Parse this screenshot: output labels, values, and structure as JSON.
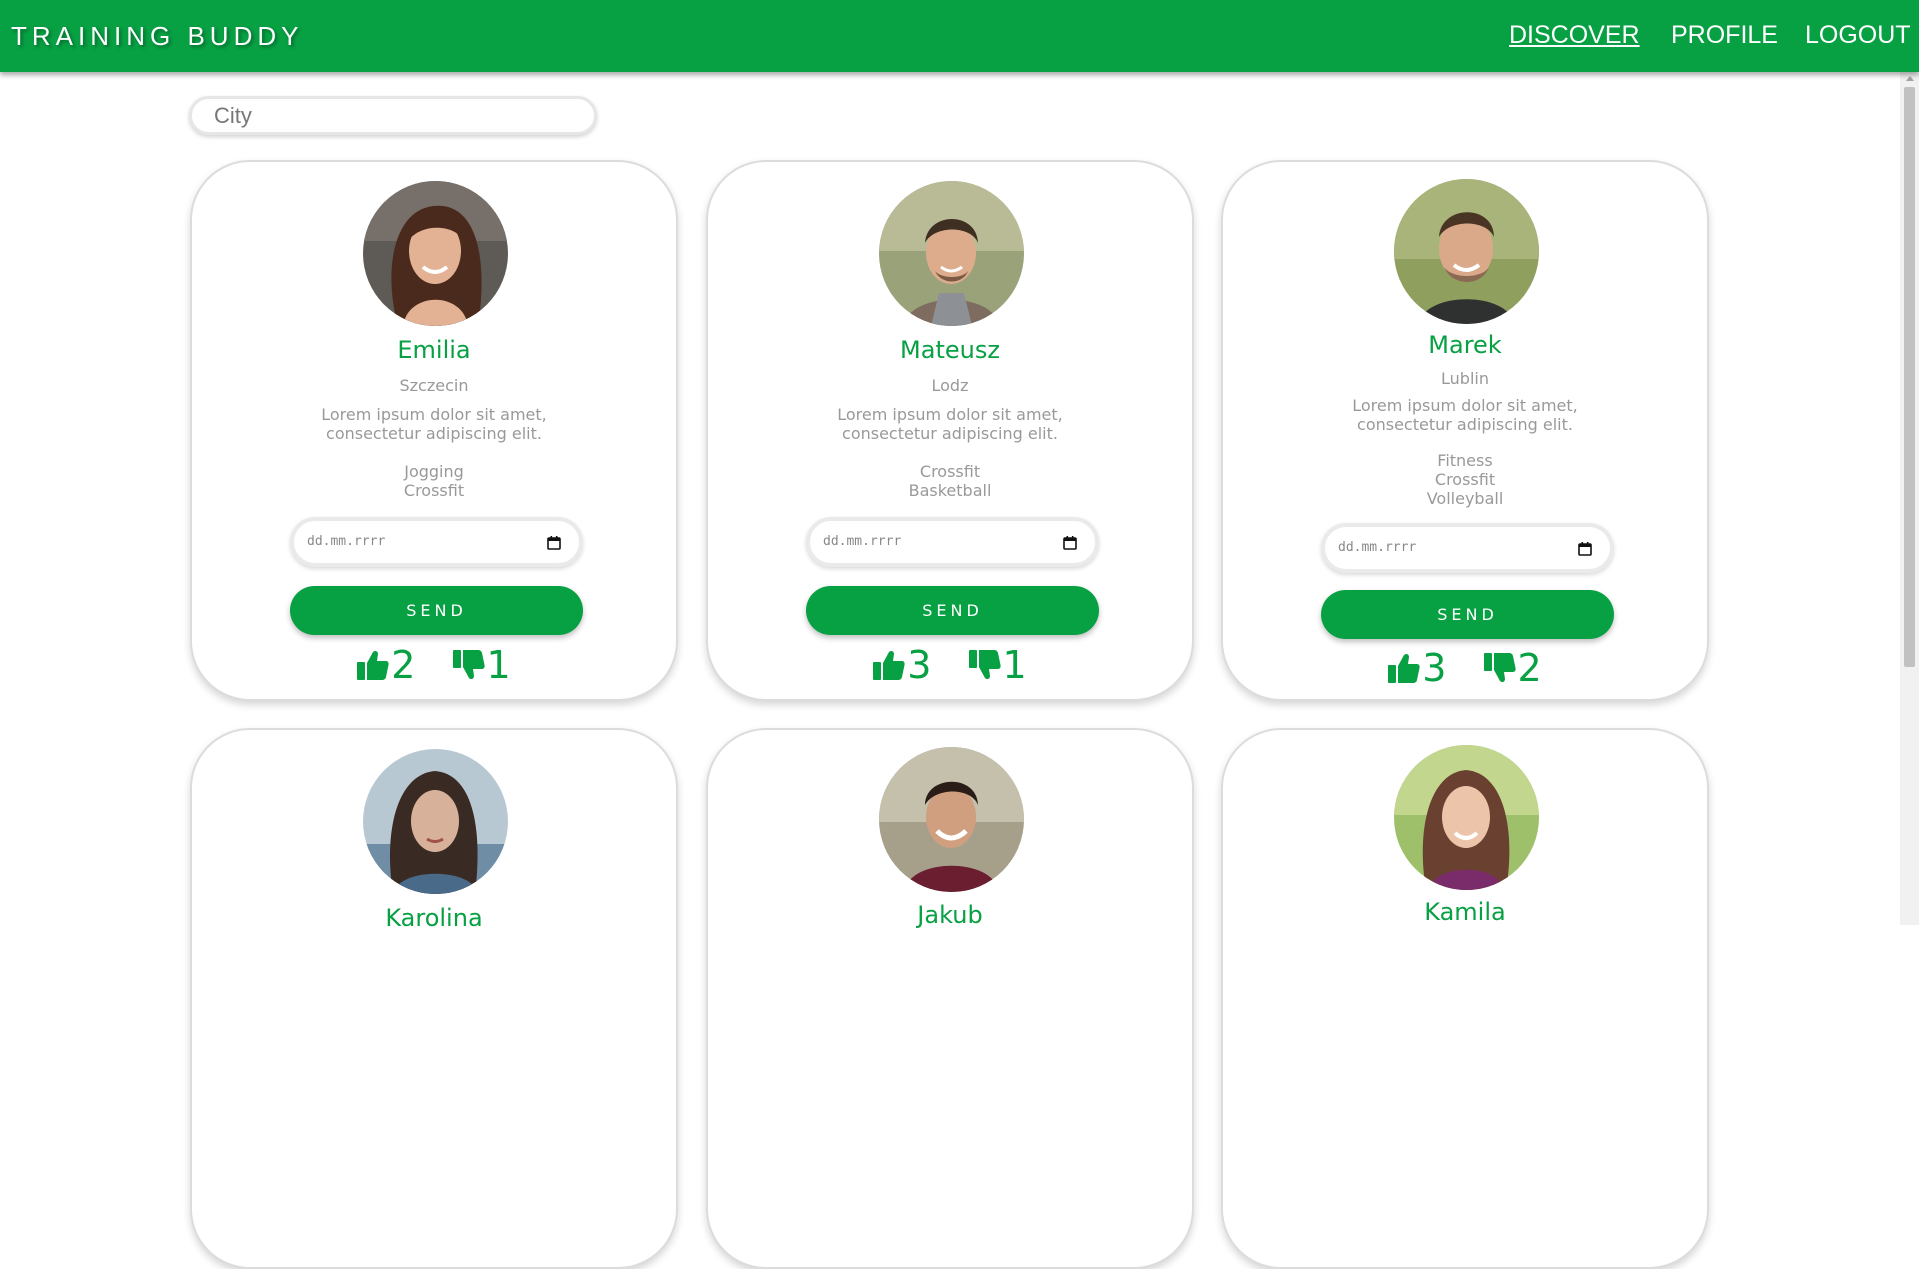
{
  "header": {
    "brand": "TRAINING BUDDY",
    "nav": [
      "DISCOVER",
      "PROFILE",
      "LOGOUT"
    ]
  },
  "search": {
    "placeholder": "City"
  },
  "cards": [
    {
      "name": "Emilia",
      "city": "Szczecin",
      "desc_line1": "Lorem ipsum dolor sit amet,",
      "desc_line2": "consectetur adipiscing elit.",
      "sports": [
        "Jogging",
        "Crossfit"
      ],
      "date_placeholder": "dd.mm.rrrr",
      "send": "SEND",
      "likes": "2",
      "dislikes": "1"
    },
    {
      "name": "Mateusz",
      "city": "Lodz",
      "desc_line1": "Lorem ipsum dolor sit amet,",
      "desc_line2": "consectetur adipiscing elit.",
      "sports": [
        "Crossfit",
        "Basketball"
      ],
      "date_placeholder": "dd.mm.rrrr",
      "send": "SEND",
      "likes": "3",
      "dislikes": "1"
    },
    {
      "name": "Marek",
      "city": "Lublin",
      "desc_line1": "Lorem ipsum dolor sit amet,",
      "desc_line2": "consectetur adipiscing elit.",
      "sports": [
        "Fitness",
        "Crossfit",
        "Volleyball"
      ],
      "date_placeholder": "dd.mm.rrrr",
      "send": "SEND",
      "likes": "3",
      "dislikes": "2"
    },
    {
      "name": "Karolina"
    },
    {
      "name": "Jakub"
    },
    {
      "name": "Kamila"
    }
  ],
  "colors": {
    "brand_green": "#07a043",
    "muted_text": "#999999"
  },
  "icons": [
    "thumbs-up-icon",
    "thumbs-down-icon",
    "calendar-icon"
  ]
}
